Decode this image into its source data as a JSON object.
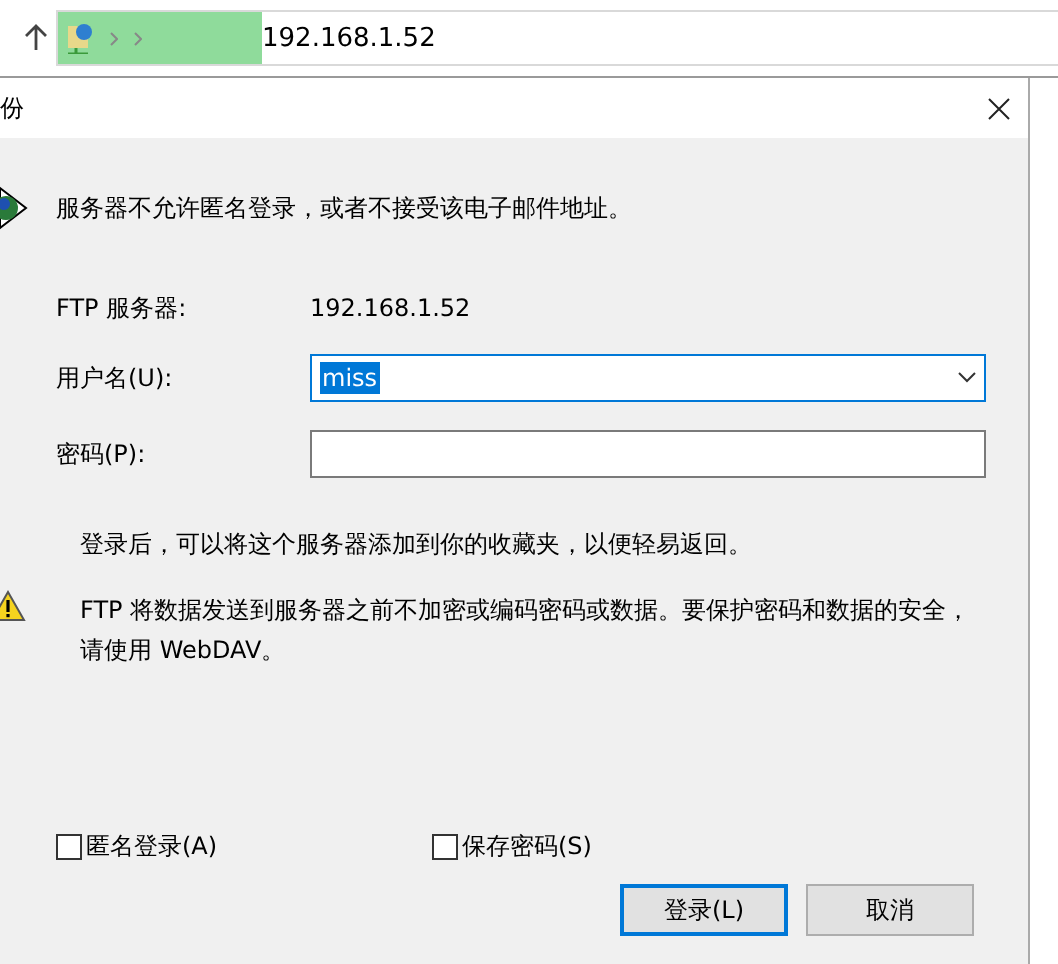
{
  "address_bar": {
    "path": "192.168.1.52"
  },
  "dialog": {
    "title": "份",
    "message": "服务器不允许匿名登录，或者不接受该电子邮件地址。",
    "fields": [
      {
        "kind": "static",
        "label": "FTP 服务器:",
        "value": "192.168.1.52"
      },
      {
        "kind": "combo",
        "label": "用户名(U):",
        "value": "miss"
      },
      {
        "kind": "password",
        "label": "密码(P):"
      }
    ],
    "hint": "登录后，可以将这个服务器添加到你的收藏夹，以便轻易返回。",
    "warning": "FTP 将数据发送到服务器之前不加密或编码密码或数据。要保护密码和数据的安全，请使用 WebDAV。",
    "checkboxes": [
      {
        "label": "匿名登录(A)",
        "checked": false
      },
      {
        "label": "保存密码(S)",
        "checked": false
      }
    ],
    "buttons": [
      {
        "label": "登录(L)",
        "default": true
      },
      {
        "label": "取消",
        "default": false
      }
    ]
  }
}
